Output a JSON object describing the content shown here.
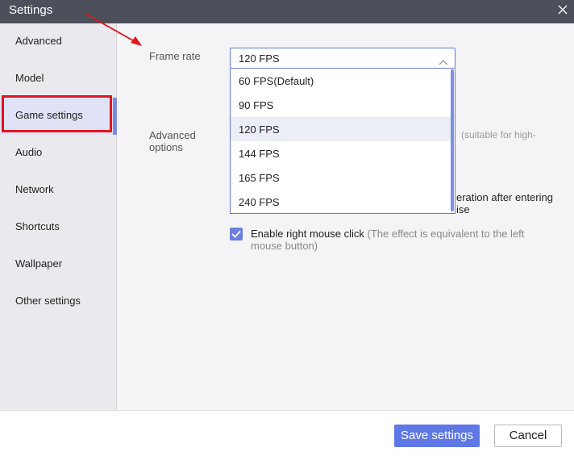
{
  "window": {
    "title": "Settings"
  },
  "sidebar": {
    "items": [
      {
        "label": "Advanced"
      },
      {
        "label": "Model"
      },
      {
        "label": "Game settings"
      },
      {
        "label": "Audio"
      },
      {
        "label": "Network"
      },
      {
        "label": "Shortcuts"
      },
      {
        "label": "Wallpaper"
      },
      {
        "label": "Other settings"
      }
    ],
    "active_index": 2
  },
  "main": {
    "frame_rate": {
      "label": "Frame rate",
      "selected": "120 FPS",
      "options": [
        "60 FPS(Default)",
        "90 FPS",
        "120 FPS",
        "144 FPS",
        "165 FPS",
        "240 FPS"
      ]
    },
    "advanced_options": {
      "label_line1": "Advanced",
      "label_line2": "options",
      "hidden_hint": "(suitable for high-",
      "partial_line1": "eration after entering",
      "partial_line2": "ise"
    },
    "right_click": {
      "label": "Enable right mouse click",
      "note": " (The effect is equivalent to the left mouse button)",
      "checked": true
    }
  },
  "footer": {
    "save_label": "Save settings",
    "cancel_label": "Cancel"
  },
  "colors": {
    "accent": "#5f78e6",
    "titlebar": "#4d4f5b",
    "annotation_red": "#e0161e"
  }
}
